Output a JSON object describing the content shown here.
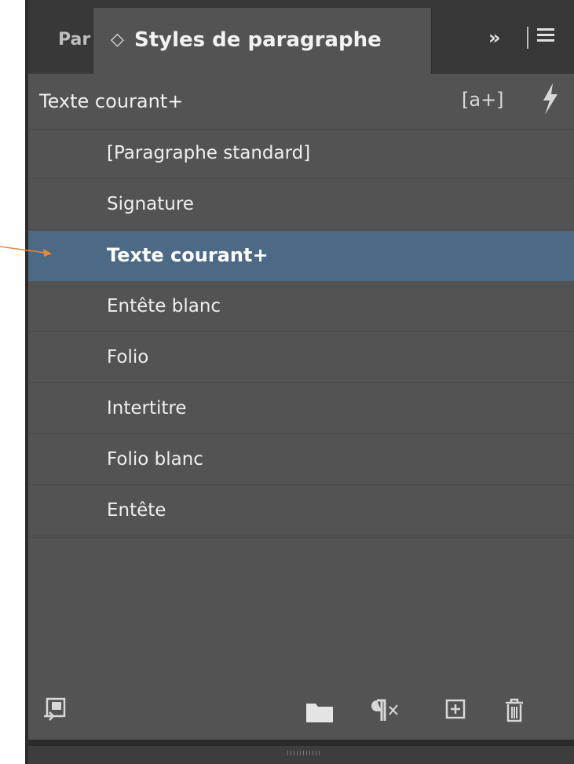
{
  "tabs": {
    "inactive_label": "Par",
    "active_label": "Styles de paragraphe",
    "more_label": "»"
  },
  "current_style": "Texte courant+",
  "styles": [
    {
      "label": "[Paragraphe standard]",
      "selected": false
    },
    {
      "label": "Signature",
      "selected": false
    },
    {
      "label": "Texte courant+",
      "selected": true
    },
    {
      "label": "Entête blanc",
      "selected": false
    },
    {
      "label": "Folio",
      "selected": false
    },
    {
      "label": "Intertitre",
      "selected": false
    },
    {
      "label": "Folio blanc",
      "selected": false
    },
    {
      "label": "Entête",
      "selected": false
    }
  ],
  "icons": {
    "create_style_from_selection": "a-plus-icon",
    "quick_apply": "lightning-icon",
    "load_styles": "load-styles-icon",
    "new_group": "folder-icon",
    "clear_overrides": "pilcrow-clear-icon",
    "new_style": "plus-box-icon",
    "delete": "trash-icon",
    "menu": "hamburger-icon"
  },
  "colors": {
    "panel_bg": "#535353",
    "selection": "#4c6a86",
    "annotation_arrow": "#e8883a"
  }
}
